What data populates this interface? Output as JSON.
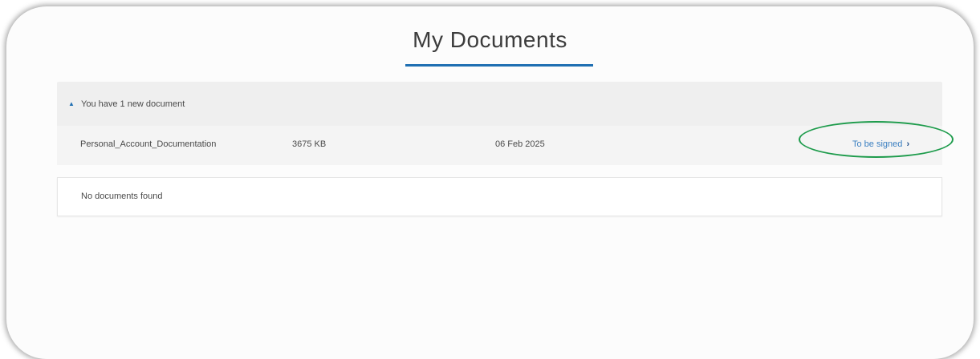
{
  "page": {
    "title": "My Documents",
    "accent_color": "#1f6fb2",
    "highlight_color": "#1d9b4b"
  },
  "new_documents": {
    "header_icon": "chevron-up-icon",
    "header_text": "You have 1 new document",
    "rows": [
      {
        "name": "Personal_Account_Documentation",
        "size": "3675 KB",
        "date": "06 Feb 2025",
        "action_label": "To be signed",
        "action_icon": "chevron-right-icon"
      }
    ]
  },
  "other_documents": {
    "empty_text": "No documents found"
  }
}
